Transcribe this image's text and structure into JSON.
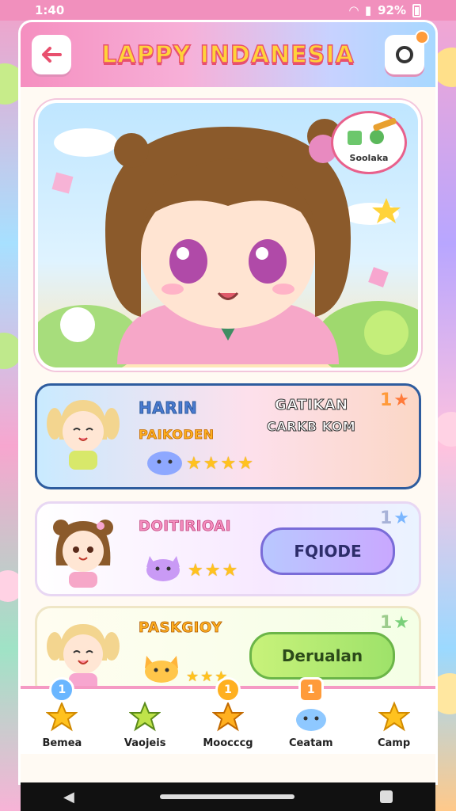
{
  "status_bar": {
    "time": "1:40",
    "battery": "92%"
  },
  "header": {
    "title": "LAPPY INDANESIA"
  },
  "hero": {
    "speech_label": "Soolaka"
  },
  "cards": [
    {
      "name": "HARIN",
      "subtitle": "PAIKODEN",
      "info_line1": "GATIKAN",
      "info_line2": "CARKB KOM",
      "rank": "1",
      "stars": 4
    },
    {
      "name": "DOITIRIOAI",
      "button": "FQIODE",
      "rank": "1",
      "stars": 3
    },
    {
      "name": "PASKGIOY",
      "button": "Derualan",
      "rank": "1",
      "stars": 3
    }
  ],
  "nav": [
    {
      "label": "Bemea",
      "badge": "1"
    },
    {
      "label": "Vaojeis"
    },
    {
      "label": "Moocccg",
      "badge": "1"
    },
    {
      "label": "Ceatam",
      "badge": "1"
    },
    {
      "label": "Camp"
    }
  ],
  "colors": {
    "accent_pink": "#f58fc0",
    "accent_blue": "#a8d8ff",
    "title_yellow": "#ffd33a",
    "star": "#ffc21f"
  }
}
